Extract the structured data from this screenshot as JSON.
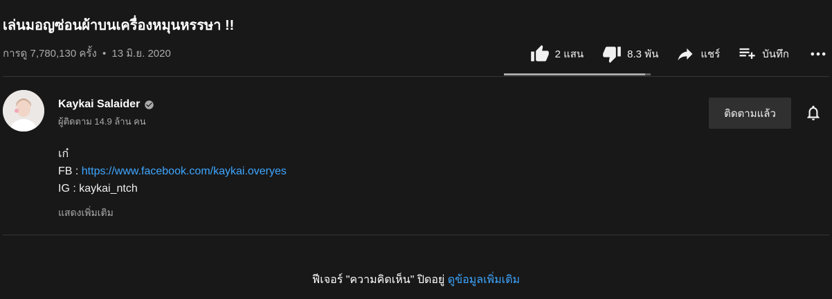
{
  "video": {
    "title": "เล่นมอญซ่อนผ้าบนเครื่องหมุนหรรษา !!",
    "views": "การดู 7,780,130 ครั้ง",
    "separator": "•",
    "date": "13 มิ.ย. 2020"
  },
  "actions": {
    "like_label": "2 แสน",
    "dislike_label": "8.3 พัน",
    "share_label": "แชร์",
    "save_label": "บันทึก",
    "like_ratio": 0.96
  },
  "icons": {
    "like": "thumbs-up-icon",
    "dislike": "thumbs-down-icon",
    "share": "share-arrow-icon",
    "save": "playlist-add-icon",
    "more": "more-horizontal-icon",
    "verified": "verified-check-icon",
    "bell": "notification-bell-icon"
  },
  "channel": {
    "name": "Kaykai Salaider",
    "subscribers": "ผู้ติดตาม 14.9 ล้าน คน",
    "subscribe_label": "ติดตามแล้ว"
  },
  "description": {
    "line1": "เก๋",
    "fb_prefix": "FB : ",
    "fb_link": "https://www.facebook.com/kaykai.overyes",
    "ig_line": "IG : kaykai_ntch",
    "show_more": "แสดงเพิ่มเติม"
  },
  "comments": {
    "off_text": "ฟีเจอร์ \"ความคิดเห็น\" ปิดอยู่",
    "learn_more": "ดูข้อมูลเพิ่มเติม"
  },
  "colors": {
    "background": "#181818",
    "link": "#3ea6ff",
    "secondary_text": "#aaaaaa",
    "button_bg": "#303030"
  }
}
